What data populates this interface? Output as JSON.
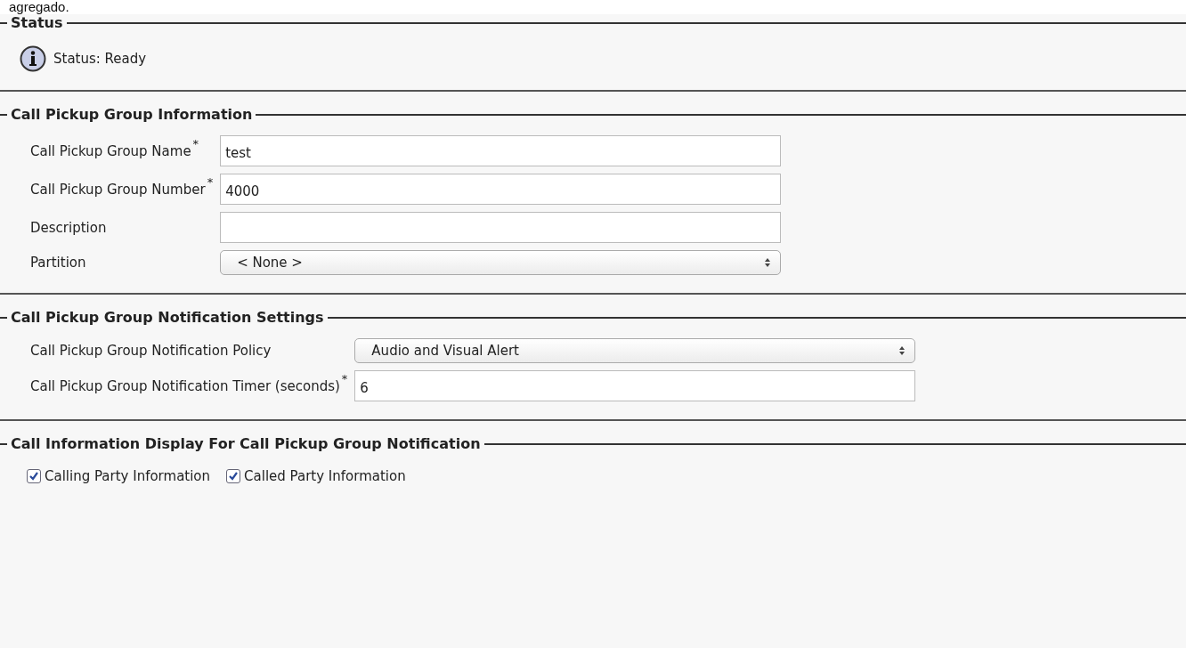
{
  "caption": "agregado.",
  "sections": [
    {
      "title": "Status",
      "kind": "status",
      "status": "Status: Ready"
    },
    {
      "title": "Call Pickup Group Information",
      "kind": "form",
      "fields": [
        {
          "kind": "text",
          "label": "Call Pickup Group Name",
          "required_mark": "*",
          "value": "test"
        },
        {
          "kind": "text",
          "label": "Call Pickup Group Number",
          "required_mark": "*",
          "value": "4000"
        },
        {
          "kind": "text",
          "label": "Description"
        },
        {
          "kind": "select",
          "label": "Partition",
          "value": "< None >"
        }
      ]
    },
    {
      "title": "Call Pickup Group Notification Settings",
      "kind": "form",
      "fields": [
        {
          "kind": "select",
          "label": "Call Pickup Group Notification Policy",
          "value": "Audio and Visual Alert"
        },
        {
          "kind": "text",
          "label": "Call Pickup Group Notification Timer (seconds)",
          "required_mark": "*",
          "value": "6"
        }
      ]
    },
    {
      "title": "Call Information Display For Call Pickup Group Notification",
      "kind": "checks",
      "checks": [
        {
          "label": "Calling Party Information",
          "checked": true
        },
        {
          "label": "Called Party Information",
          "checked": true
        }
      ]
    }
  ]
}
